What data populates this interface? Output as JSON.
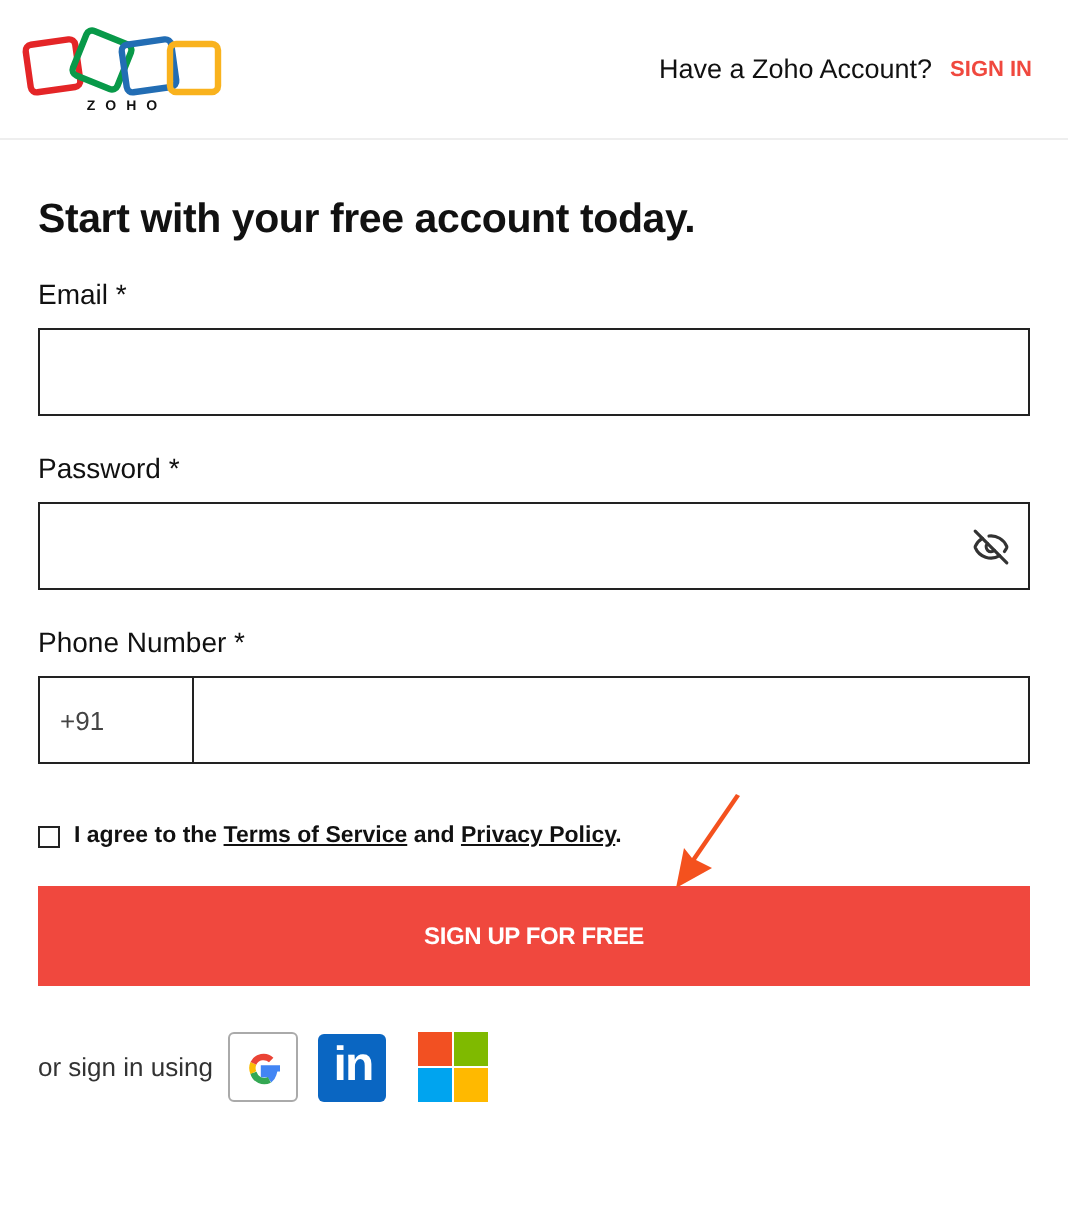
{
  "header": {
    "logo_text": "ZOHO",
    "prompt": "Have a Zoho Account?",
    "sign_in": "SIGN IN"
  },
  "title": "Start with your free account today.",
  "fields": [
    {
      "kind": "email",
      "label": "Email *"
    },
    {
      "kind": "password",
      "label": "Password *"
    },
    {
      "kind": "phone",
      "label": "Phone Number *",
      "country_code": "+91"
    }
  ],
  "agreement": {
    "checked": false,
    "before": "I agree to the",
    "terms": "Terms of Service",
    "middle": "and",
    "privacy": "Privacy Policy",
    "after": "."
  },
  "signup_button": "SIGN UP FOR FREE",
  "social": {
    "label": "or sign in using",
    "providers": [
      {
        "kind": "google"
      },
      {
        "kind": "linkedin",
        "text": "in"
      },
      {
        "kind": "microsoft"
      }
    ]
  }
}
